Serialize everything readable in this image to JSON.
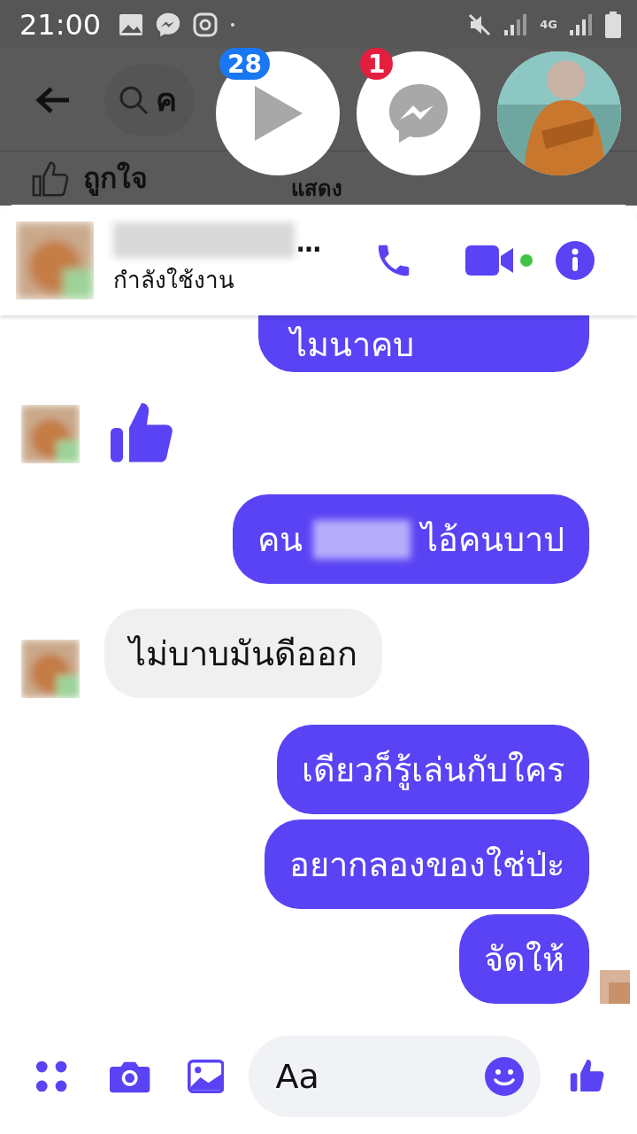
{
  "status_bar": {
    "time": "21:00",
    "network": "4G"
  },
  "background_app": {
    "search_text": "ค",
    "like_label": "ถูกใจ",
    "comment_label": "แสดง"
  },
  "chat_heads": [
    {
      "kind": "video",
      "badge": "28",
      "color": "#1877f2"
    },
    {
      "kind": "messenger",
      "badge": "1",
      "color": "#e41e3f"
    },
    {
      "kind": "avatar"
    }
  ],
  "chat": {
    "name_suffix": "…",
    "status": "กำลังใช้งาน",
    "online": true
  },
  "messages": [
    {
      "kind": "text",
      "outgoing": true,
      "parts": [
        "ไมนาคบ"
      ]
    },
    {
      "kind": "like",
      "outgoing": false
    },
    {
      "kind": "text",
      "outgoing": true,
      "parts": [
        "คน",
        "ไอ้คนบาป"
      ]
    },
    {
      "kind": "text",
      "outgoing": false,
      "parts": [
        "ไม่บาบมันดีออก"
      ]
    },
    {
      "kind": "text",
      "outgoing": true,
      "parts": [
        "เดียวก็รู้เล่นกับใคร"
      ]
    },
    {
      "kind": "text",
      "outgoing": true,
      "parts": [
        "อยากลองของใช่ป่ะ"
      ]
    },
    {
      "kind": "text",
      "outgoing": true,
      "parts": [
        "จัดให้"
      ],
      "seen": true
    }
  ],
  "composer": {
    "placeholder": "Aa"
  }
}
